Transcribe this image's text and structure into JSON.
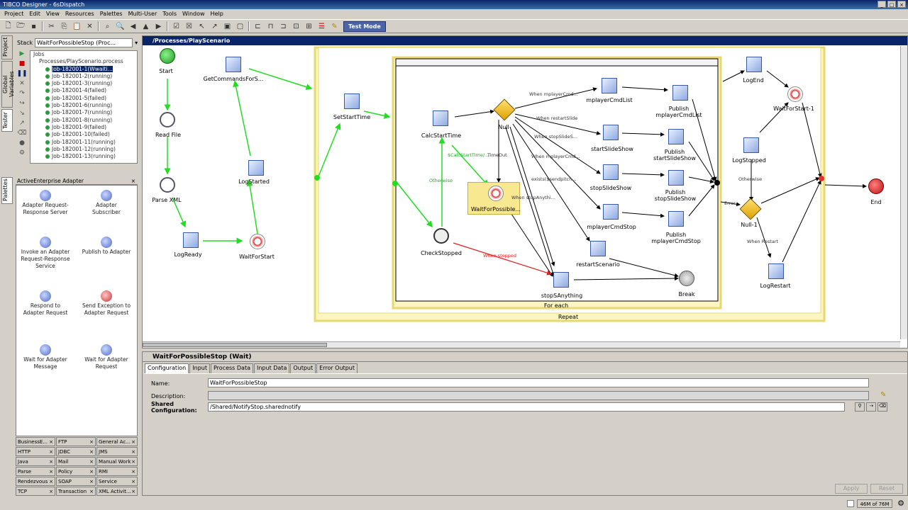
{
  "window": {
    "title": "TIBCO Designer - 6sDispatch"
  },
  "menu": [
    "Project",
    "Edit",
    "View",
    "Resources",
    "Palettes",
    "Multi-User",
    "Tools",
    "Window",
    "Help"
  ],
  "toolbar": {
    "test_mode_label": "Test Mode"
  },
  "left_tabs": [
    "Project",
    "Global Variables",
    "Tester"
  ],
  "palettes_tab": "Palettes",
  "tester": {
    "stack_label": "Stack",
    "stack_value": "WaitForPossibleStop (Proc...",
    "jobs_root": "Jobs",
    "process_node": "Processes/PlayScenario.process",
    "jobs": [
      "Job-182001-1(Wwaiti...",
      "Job-182001-2(running)",
      "Job-182001-3(running)",
      "Job-182001-4(failed)",
      "Job-182001-5(failed)",
      "Job-182001-6(running)",
      "Job-182001-7(running)",
      "Job-182001-8(running)",
      "Job-182001-9(failed)",
      "Job-182001-10(failed)",
      "Job-182001-11(running)",
      "Job-182001-12(running)",
      "Job-182001-13(running)"
    ]
  },
  "palette": {
    "header": "ActiveEnterprise Adapter",
    "items": [
      {
        "label": "Adapter Request-Response Server"
      },
      {
        "label": "Adapter Subscriber"
      },
      {
        "label": "Invoke an Adapter Request-Response Service"
      },
      {
        "label": "Publish to Adapter"
      },
      {
        "label": "Respond to Adapter Request"
      },
      {
        "label": "Send Exception to Adapter Request"
      },
      {
        "label": "Wait for Adapter Message"
      },
      {
        "label": "Wait for Adapter Request"
      }
    ],
    "tabs": [
      "BusinessE...",
      "FTP",
      "General Ac...",
      "HTTP",
      "JDBC",
      "JMS",
      "Java",
      "Mail",
      "Manual Work",
      "Parse",
      "Policy",
      "RMI",
      "Rendezvous",
      "SOAP",
      "Service",
      "TCP",
      "Transaction",
      "XML Activit..."
    ]
  },
  "design": {
    "header": "/Processes/PlayScenario",
    "nodes": {
      "start": "Start",
      "read_file": "Read File",
      "parse_xml": "Parse XML",
      "log_ready": "LogReady",
      "wait_for_start": "WaitForStart",
      "log_started": "LogStarted",
      "get_commands": "GetCommandsForS...",
      "set_start_time": "SetStartTime",
      "calc_start_time": "CalcStartTime",
      "null": "Null",
      "wait_possible": "WaitForPossible...",
      "check_stopped": "CheckStopped",
      "stop_s_anything": "stopSAnything",
      "mplayer_cmd_list": "mplayerCmdList",
      "publish_mplayer_cmd_list": "Publish mplayerCmdList",
      "start_slide_show": "startSlideShow",
      "publish_start_slide_show": "Publish startSlideShow",
      "stop_slide_show": "stopSlideShow",
      "publish_stop_slide_show": "Publish stopSlideShow",
      "mplayer_cmd_stop": "mplayerCmdStop",
      "publish_mplayer_cmd_stop": "Publish mplayerCmdStop",
      "restart_scenario": "restartScenario",
      "break": "Break",
      "log_end": "LogEnd",
      "wait_for_start_1": "WaitForStart-1",
      "log_stopped": "LogStopped",
      "null_1": "Null-1",
      "log_restart": "LogRestart",
      "end": "End",
      "for_each": "For each",
      "repeat": "Repeat"
    },
    "edge_labels": {
      "when_mplayer_cmd": "When mplayerCmd...",
      "when_restart_slide": "When restartSlide",
      "when_stop_slide": "When stopSlideS...",
      "when_mplayer_cmd2": "When mplayerCmd...",
      "exists_sendpitch": "exists($sendpitch...",
      "when_stop_anything": "When stopAnythi...",
      "calc_start_time_cond": "$CalcStartTime/...",
      "timeout": "TimeOut",
      "otherwise": "Otherwise",
      "when_stopped": "When stopped",
      "error": "Error",
      "otherwise2": "Otherwise",
      "when_restart": "When Restart"
    }
  },
  "props": {
    "header": "WaitForPossibleStop (Wait)",
    "tabs": [
      "Configuration",
      "Input",
      "Process Data",
      "Input Data",
      "Output",
      "Error Output"
    ],
    "name_label": "Name:",
    "name_value": "WaitForPossibleStop",
    "description_label": "Description:",
    "description_value": "",
    "shared_config_label": "Shared Configuration:",
    "shared_config_value": "/Shared/NotifyStop.sharednotify",
    "apply": "Apply",
    "reset": "Reset"
  },
  "status": {
    "memory": "46M of 76M"
  },
  "colors": {
    "success_edge": "#22dd22",
    "error_edge": "#dd2222",
    "group_bg": "#fbf5c2",
    "selection": "#0a246a"
  }
}
